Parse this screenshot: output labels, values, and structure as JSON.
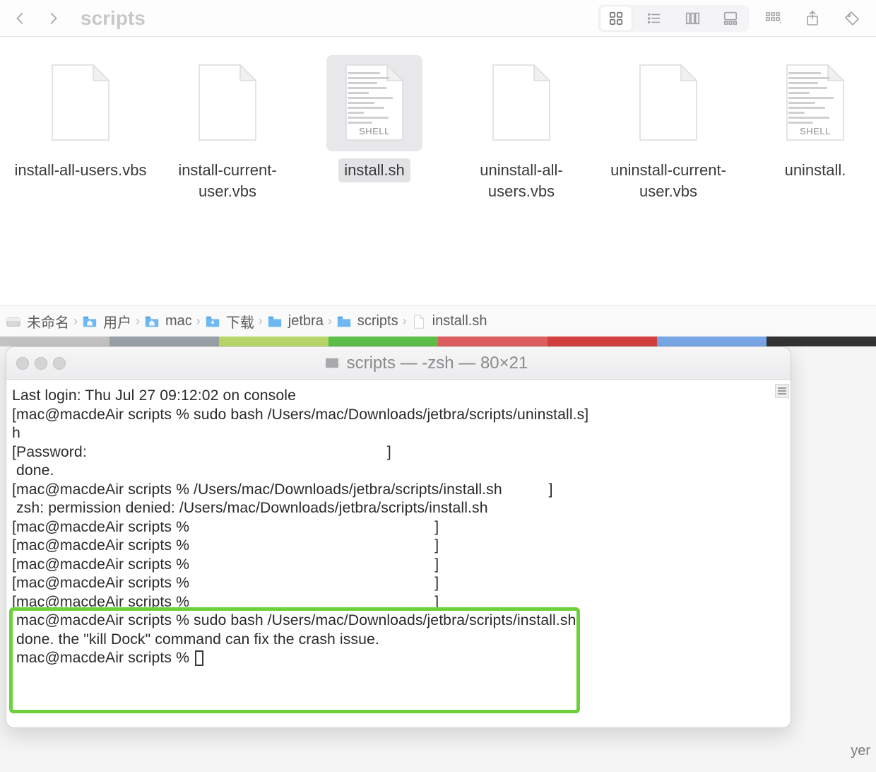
{
  "toolbar": {
    "title": "scripts"
  },
  "files": [
    {
      "name": "install-all-users.vbs",
      "selected": false,
      "type": "blank"
    },
    {
      "name": "install-current-user.vbs",
      "selected": false,
      "type": "blank"
    },
    {
      "name": "install.sh",
      "selected": true,
      "type": "shell"
    },
    {
      "name": "uninstall-all-users.vbs",
      "selected": false,
      "type": "blank"
    },
    {
      "name": "uninstall-current-user.vbs",
      "selected": false,
      "type": "blank"
    },
    {
      "name": "uninstall.",
      "selected": false,
      "type": "shell"
    }
  ],
  "shell_badge": "SHELL",
  "path": [
    {
      "label": "未命名",
      "icon": "disk"
    },
    {
      "label": "用户",
      "icon": "folder-home"
    },
    {
      "label": "mac",
      "icon": "folder-home"
    },
    {
      "label": "下载",
      "icon": "folder-dl"
    },
    {
      "label": "jetbra",
      "icon": "folder"
    },
    {
      "label": "scripts",
      "icon": "folder"
    },
    {
      "label": "install.sh",
      "icon": "file"
    }
  ],
  "terminal": {
    "title": "scripts — -zsh — 80×21",
    "lines": [
      "Last login: Thu Jul 27 09:12:02 on console",
      "[mac@macdeAir scripts % sudo bash /Users/mac/Downloads/jetbra/scripts/uninstall.s]",
      "h",
      "[Password:                                                                       ]",
      " done.",
      "[mac@macdeAir scripts % /Users/mac/Downloads/jetbra/scripts/install.sh           ]",
      " zsh: permission denied: /Users/mac/Downloads/jetbra/scripts/install.sh",
      "[mac@macdeAir scripts %                                                          ]",
      "[mac@macdeAir scripts %                                                          ]",
      "[mac@macdeAir scripts %                                                          ]",
      "[mac@macdeAir scripts %                                                          ]",
      "[mac@macdeAir scripts %                                                          ]",
      " mac@macdeAir scripts % sudo bash /Users/mac/Downloads/jetbra/scripts/install.sh",
      "",
      " done. the \"kill Dock\" command can fix the crash issue.",
      " mac@macdeAir scripts % "
    ]
  },
  "bg_text": "yer"
}
